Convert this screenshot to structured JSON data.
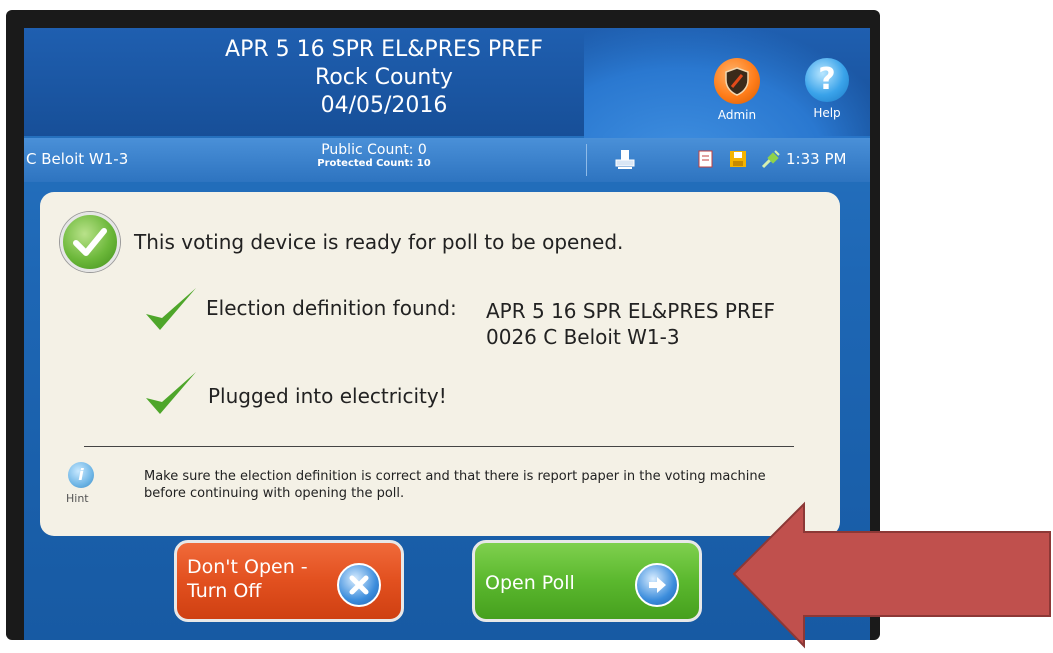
{
  "header": {
    "election": "APR 5 16 SPR EL&PRES PREF",
    "county": "Rock County",
    "date": "04/05/2016",
    "admin_label": "Admin",
    "help_label": "Help",
    "help_glyph": "?"
  },
  "status": {
    "precinct": "C Beloit W1-3",
    "public_count": "Public Count: 0",
    "protected_count": "Protected Count: 10",
    "time": "1:33 PM",
    "icons": [
      "printer-icon",
      "report-icon",
      "save-icon",
      "plug-icon"
    ]
  },
  "main": {
    "ready_message": "This voting device is ready for poll to be opened.",
    "election_def_label": "Election definition found:",
    "election_def_line1": "APR 5 16 SPR EL&PRES PREF",
    "election_def_line2": "0026 C Beloit W1-3",
    "power_message": "Plugged into electricity!",
    "hint_glyph": "i",
    "hint_label": "Hint",
    "hint_text": "Make sure the election definition is correct and that there is report paper in the voting machine before continuing with opening the poll."
  },
  "buttons": {
    "dont_open_line1": "Don't Open -",
    "dont_open_line2": "Turn Off",
    "open_poll": "Open Poll"
  },
  "colors": {
    "screen_blue": "#1e67b5",
    "panel_bg": "#f4f1e6",
    "red_button": "#e2501f",
    "green_button": "#5bb82e",
    "annotation_arrow": "#c0504d"
  }
}
